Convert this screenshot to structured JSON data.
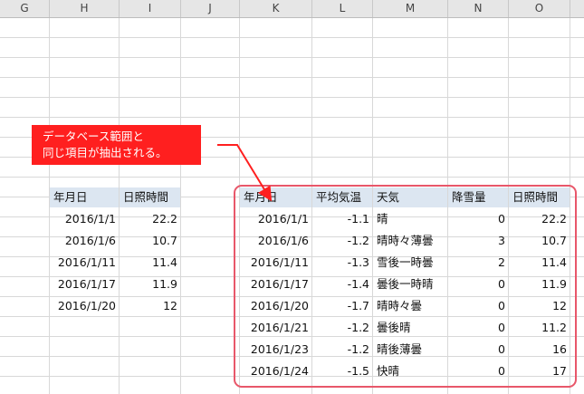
{
  "columns": [
    "G",
    "H",
    "I",
    "J",
    "K",
    "L",
    "M",
    "N",
    "O"
  ],
  "criteria": {
    "headers": [
      "年月日",
      "日照時間"
    ],
    "rows": [
      [
        "2016/1/1",
        "22.2"
      ],
      [
        "2016/1/6",
        "10.7"
      ],
      [
        "2016/1/11",
        "11.4"
      ],
      [
        "2016/1/17",
        "11.9"
      ],
      [
        "2016/1/20",
        "12"
      ]
    ]
  },
  "result": {
    "headers": [
      "年月日",
      "平均気温",
      "天気",
      "降雪量",
      "日照時間"
    ],
    "rows": [
      [
        "2016/1/1",
        "-1.1",
        "晴",
        "0",
        "22.2"
      ],
      [
        "2016/1/6",
        "-1.2",
        "晴時々薄曇",
        "3",
        "10.7"
      ],
      [
        "2016/1/11",
        "-1.3",
        "雪後一時曇",
        "2",
        "11.4"
      ],
      [
        "2016/1/17",
        "-1.4",
        "曇後一時晴",
        "0",
        "11.9"
      ],
      [
        "2016/1/20",
        "-1.7",
        "晴時々曇",
        "0",
        "12"
      ],
      [
        "2016/1/21",
        "-1.2",
        "曇後晴",
        "0",
        "11.2"
      ],
      [
        "2016/1/23",
        "-1.2",
        "晴後薄曇",
        "0",
        "16"
      ],
      [
        "2016/1/24",
        "-1.5",
        "快晴",
        "0",
        "17"
      ]
    ]
  },
  "callout": {
    "line1": "データベース範囲と",
    "line2": "同じ項目が抽出される。"
  },
  "colors": {
    "callout_bg": "#ff1f1f",
    "highlight_border": "#e8576a",
    "header_fill": "#dce6f1"
  }
}
